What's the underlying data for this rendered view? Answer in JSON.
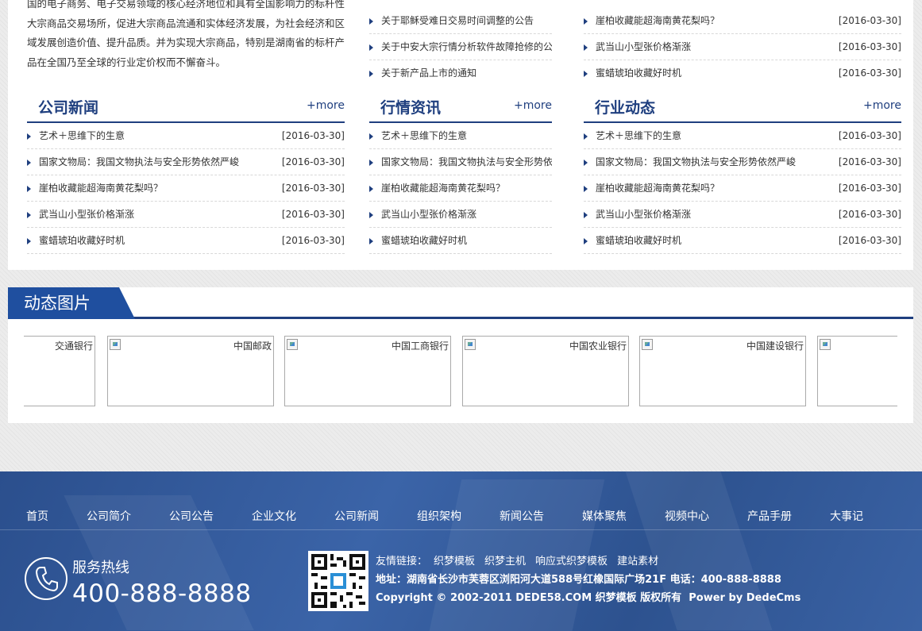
{
  "intro": {
    "text": "国的电子商务、电子交易领域的核心经济地位和具有全国影响力的标杆性大宗商品交易场所，促进大宗商品流通和实体经济发展，为社会经济和区域发展创造价值、提升品质。并为实现大宗商品，特别是湖南省的标杆产品在全国乃至全球的行业定价权而不懈奋斗。"
  },
  "notice_list": {
    "items": [
      {
        "title": "关于耶稣受难日交易时间调整的公告"
      },
      {
        "title": "关于中安大宗行情分析软件故障抢修的公"
      },
      {
        "title": "关于新产品上市的通知"
      }
    ]
  },
  "top_right_list": {
    "items": [
      {
        "title": "崖柏收藏能超海南黄花梨吗？",
        "date": "[2016-03-30]"
      },
      {
        "title": "武当山小型张价格渐涨",
        "date": "[2016-03-30]"
      },
      {
        "title": "蜜蜡琥珀收藏好时机",
        "date": "[2016-03-30]"
      }
    ]
  },
  "sections": [
    {
      "title": "公司新闻",
      "more": "+more",
      "items": [
        {
          "title": "艺术＋思维下的生意",
          "date": "[2016-03-30]"
        },
        {
          "title": "国家文物局：我国文物执法与安全形势依然严峻",
          "date": "[2016-03-30]"
        },
        {
          "title": "崖柏收藏能超海南黄花梨吗？",
          "date": "[2016-03-30]"
        },
        {
          "title": "武当山小型张价格渐涨",
          "date": "[2016-03-30]"
        },
        {
          "title": "蜜蜡琥珀收藏好时机",
          "date": "[2016-03-30]"
        }
      ]
    },
    {
      "title": "行情资讯",
      "more": "+more",
      "items": [
        {
          "title": "艺术＋思维下的生意"
        },
        {
          "title": "国家文物局：我国文物执法与安全形势依"
        },
        {
          "title": "崖柏收藏能超海南黄花梨吗？"
        },
        {
          "title": "武当山小型张价格渐涨"
        },
        {
          "title": "蜜蜡琥珀收藏好时机"
        }
      ]
    },
    {
      "title": "行业动态",
      "more": "+more",
      "items": [
        {
          "title": "艺术＋思维下的生意",
          "date": "[2016-03-30]"
        },
        {
          "title": "国家文物局：我国文物执法与安全形势依然严峻",
          "date": "[2016-03-30]"
        },
        {
          "title": "崖柏收藏能超海南黄花梨吗？",
          "date": "[2016-03-30]"
        },
        {
          "title": "武当山小型张价格渐涨",
          "date": "[2016-03-30]"
        },
        {
          "title": "蜜蜡琥珀收藏好时机",
          "date": "[2016-03-30]"
        }
      ]
    }
  ],
  "gallery": {
    "title": "动态图片",
    "cards": [
      {
        "name": "交通银行"
      },
      {
        "name": "中国邮政"
      },
      {
        "name": "中国工商银行"
      },
      {
        "name": "中国农业银行"
      },
      {
        "name": "中国建设银行"
      },
      {
        "name": ""
      }
    ]
  },
  "footer": {
    "nav": [
      "首页",
      "公司简介",
      "公司公告",
      "企业文化",
      "公司新闻",
      "组织架构",
      "新闻公告",
      "媒体聚焦",
      "视频中心",
      "产品手册",
      "大事记"
    ],
    "hotline_label": "服务热线",
    "hotline_number": "400-888-8888",
    "links_label": "友情链接：",
    "links": [
      "织梦模板",
      "织梦主机",
      "响应式织梦模板",
      "建站素材"
    ],
    "address": "地址：湖南省长沙市芙蓉区浏阳河大道588号红橡国际广场21F 电话：400-888-8888",
    "copyright": "Copyright © 2002-2011 DEDE58.COM 织梦模板 版权所有",
    "powered": "Power by DedeCms"
  },
  "colors": {
    "brand_blue": "#1f3f7f",
    "tab_blue": "#1f4f9f",
    "footer_blue": "#3b64a8"
  }
}
